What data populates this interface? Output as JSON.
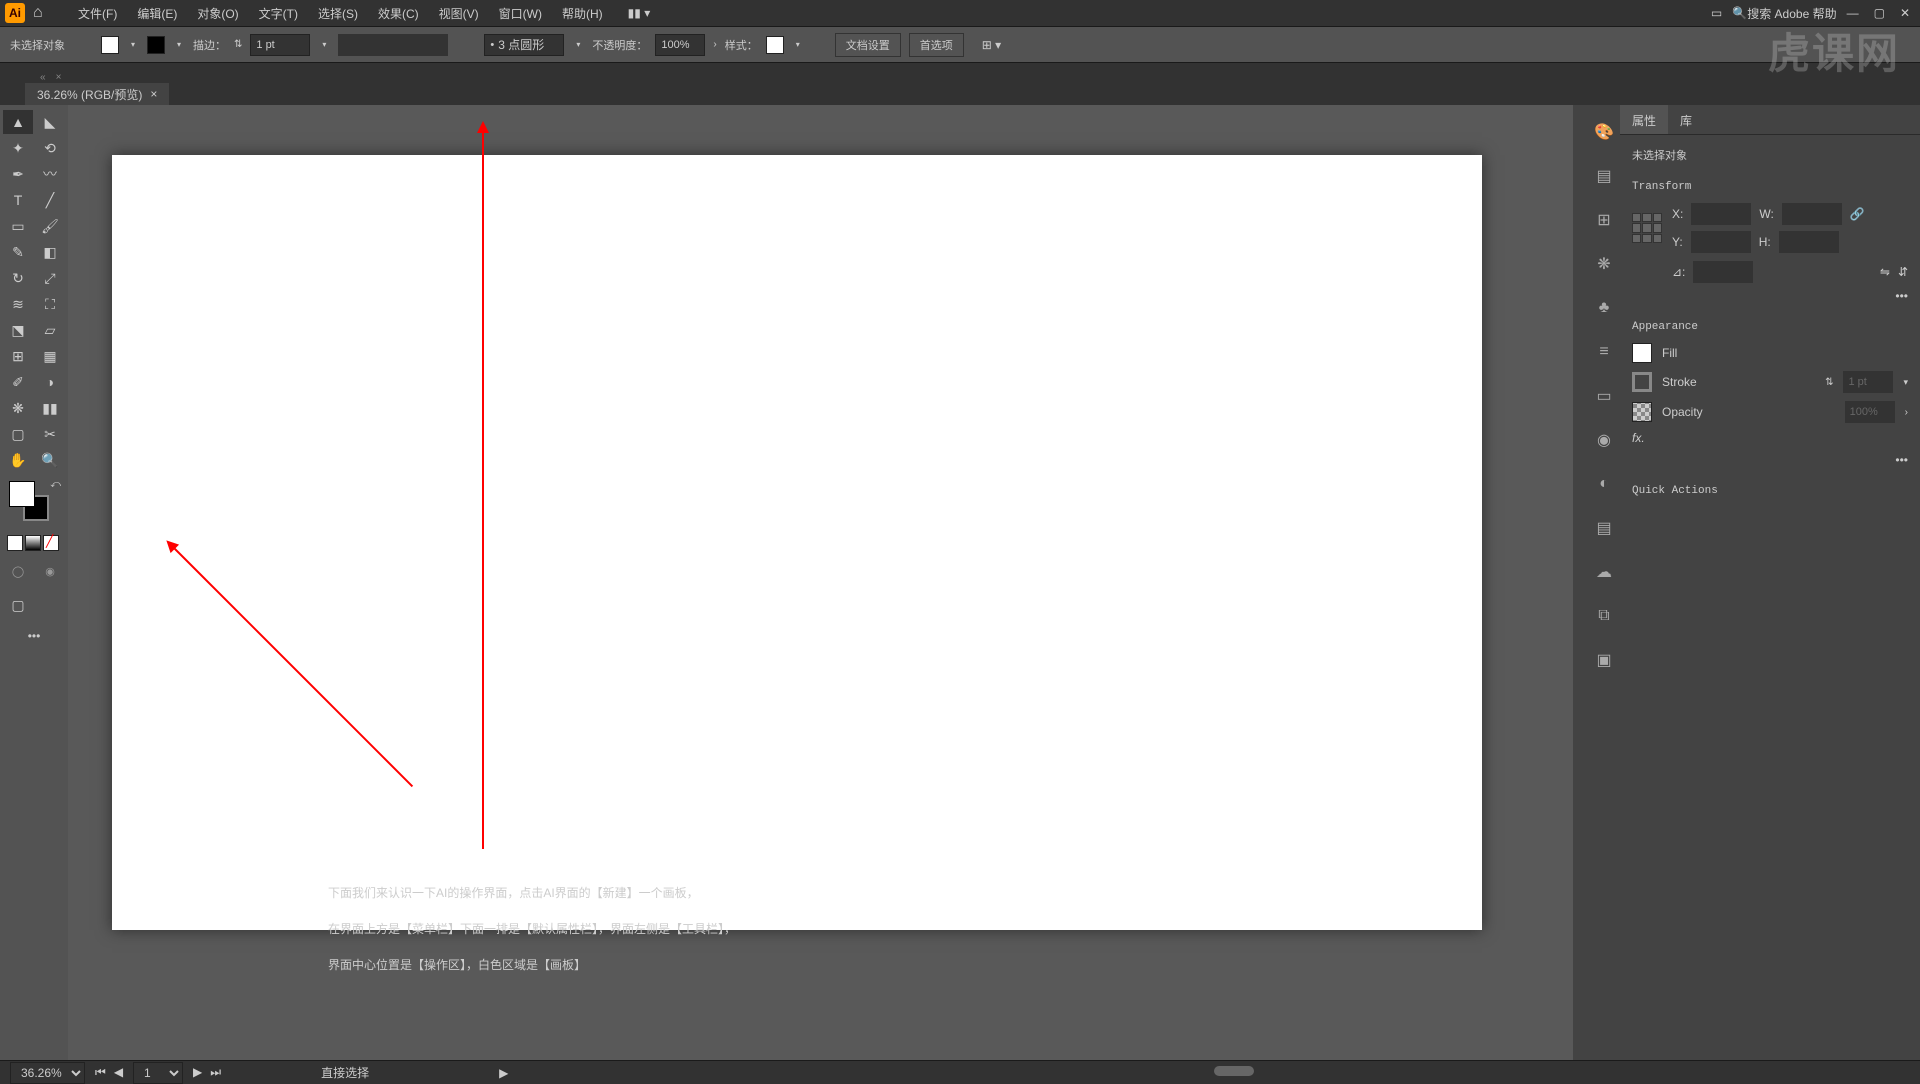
{
  "menubar": {
    "items": [
      "文件(F)",
      "编辑(E)",
      "对象(O)",
      "文字(T)",
      "选择(S)",
      "效果(C)",
      "视图(V)",
      "窗口(W)",
      "帮助(H)"
    ],
    "search_placeholder": "搜索 Adobe 帮助"
  },
  "controlbar": {
    "no_selection": "未选择对象",
    "stroke_label": "描边：",
    "stroke_value": "1 pt",
    "shape_style": "3 点圆形",
    "opacity_label": "不透明度：",
    "opacity_value": "100%",
    "style_label": "样式：",
    "doc_setup": "文档设置",
    "prefs": "首选项"
  },
  "document": {
    "tab_title": "36.26% (RGB/预览)",
    "close": "×"
  },
  "canvas": {
    "caption_line1": "下面我们来认识一下AI的操作界面，点击AI界面的【新建】一个画板，",
    "caption_line2": "在界面上方是【菜单栏】下面一排是【默认属性栏】，界面左侧是【工具栏】，",
    "caption_line3": "界面中心位置是【操作区】，白色区域是【画板】"
  },
  "properties": {
    "tab_props": "属性",
    "tab_lib": "库",
    "no_selection": "未选择对象",
    "transform_title": "Transform",
    "x_label": "X:",
    "y_label": "Y:",
    "w_label": "W:",
    "h_label": "H:",
    "angle_label": "⊿:",
    "appearance_title": "Appearance",
    "fill_label": "Fill",
    "stroke_label": "Stroke",
    "stroke_value": "1 pt",
    "opacity_label": "Opacity",
    "opacity_value": "100%",
    "fx_label": "fx.",
    "quick_actions": "Quick Actions"
  },
  "statusbar": {
    "zoom": "36.26%",
    "artboard_num": "1",
    "tool_hint": "直接选择"
  },
  "watermark": "虎课网"
}
